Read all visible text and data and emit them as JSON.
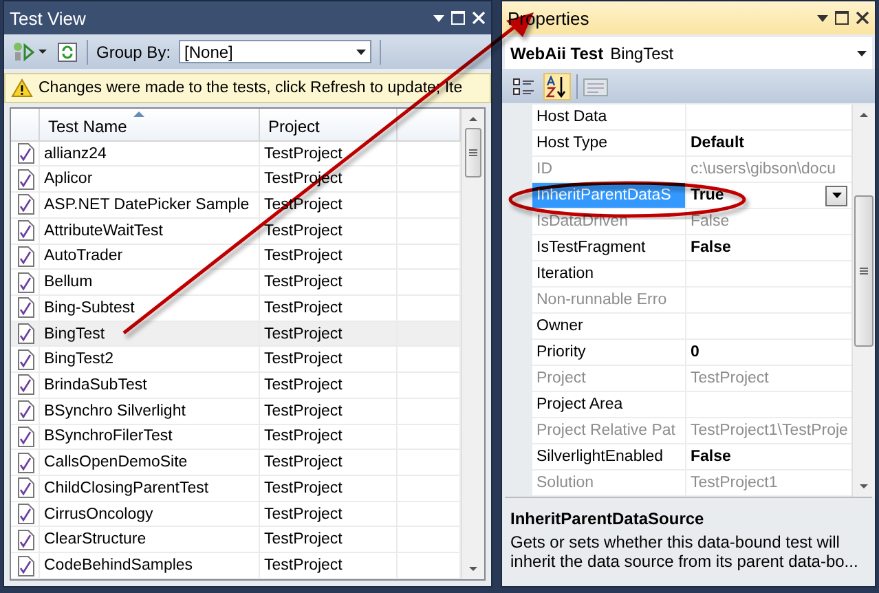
{
  "test_view": {
    "title": "Test View",
    "group_by_label": "Group By:",
    "group_by_value": "[None]",
    "warning": "Changes were made to the tests, click Refresh to update;  Ite",
    "columns": [
      "Test Name",
      "Project"
    ],
    "rows": [
      {
        "name": "allianz24",
        "project": "TestProject",
        "selected": false
      },
      {
        "name": "Aplicor",
        "project": "TestProject",
        "selected": false
      },
      {
        "name": "ASP.NET DatePicker Sample",
        "project": "TestProject",
        "selected": false
      },
      {
        "name": "AttributeWaitTest",
        "project": "TestProject",
        "selected": false
      },
      {
        "name": "AutoTrader",
        "project": "TestProject",
        "selected": false
      },
      {
        "name": "Bellum",
        "project": "TestProject",
        "selected": false
      },
      {
        "name": "Bing-Subtest",
        "project": "TestProject",
        "selected": false
      },
      {
        "name": "BingTest",
        "project": "TestProject",
        "selected": true
      },
      {
        "name": "BingTest2",
        "project": "TestProject",
        "selected": false
      },
      {
        "name": "BrindaSubTest",
        "project": "TestProject",
        "selected": false
      },
      {
        "name": "BSynchro Silverlight",
        "project": "TestProject",
        "selected": false
      },
      {
        "name": "BSynchroFilerTest",
        "project": "TestProject",
        "selected": false
      },
      {
        "name": "CallsOpenDemoSite",
        "project": "TestProject",
        "selected": false
      },
      {
        "name": "ChildClosingParentTest",
        "project": "TestProject",
        "selected": false
      },
      {
        "name": "CirrusOncology",
        "project": "TestProject",
        "selected": false
      },
      {
        "name": "ClearStructure",
        "project": "TestProject",
        "selected": false
      },
      {
        "name": "CodeBehindSamples",
        "project": "TestProject",
        "selected": false
      }
    ]
  },
  "properties": {
    "title": "Properties",
    "object_type": "WebAii Test",
    "object_name": "BingTest",
    "sort_alphabetical": true,
    "rows": [
      {
        "name": "Host Data",
        "value": "",
        "readonly": false,
        "bold": false,
        "selected": false
      },
      {
        "name": "Host Type",
        "value": "Default",
        "readonly": false,
        "bold": true,
        "selected": false
      },
      {
        "name": "ID",
        "value": "c:\\users\\gibson\\docu",
        "readonly": true,
        "bold": false,
        "selected": false
      },
      {
        "name": "InheritParentDataS",
        "value": "True",
        "readonly": false,
        "bold": true,
        "selected": true
      },
      {
        "name": "IsDataDriven",
        "value": "False",
        "readonly": true,
        "bold": false,
        "selected": false
      },
      {
        "name": "IsTestFragment",
        "value": "False",
        "readonly": false,
        "bold": true,
        "selected": false
      },
      {
        "name": "Iteration",
        "value": "",
        "readonly": false,
        "bold": false,
        "selected": false
      },
      {
        "name": "Non-runnable Erro",
        "value": "",
        "readonly": true,
        "bold": false,
        "selected": false
      },
      {
        "name": "Owner",
        "value": "",
        "readonly": false,
        "bold": false,
        "selected": false
      },
      {
        "name": "Priority",
        "value": "0",
        "readonly": false,
        "bold": true,
        "selected": false
      },
      {
        "name": "Project",
        "value": "TestProject",
        "readonly": true,
        "bold": false,
        "selected": false
      },
      {
        "name": "Project Area",
        "value": "",
        "readonly": false,
        "bold": false,
        "selected": false
      },
      {
        "name": "Project Relative Pat",
        "value": "TestProject1\\TestProje",
        "readonly": true,
        "bold": false,
        "selected": false
      },
      {
        "name": "SilverlightEnabled",
        "value": "False",
        "readonly": false,
        "bold": true,
        "selected": false
      },
      {
        "name": "Solution",
        "value": "TestProject1",
        "readonly": true,
        "bold": false,
        "selected": false
      }
    ],
    "description_title": "InheritParentDataSource",
    "description": "Gets or sets whether this data-bound test will inherit the data source from its parent data-bo..."
  }
}
